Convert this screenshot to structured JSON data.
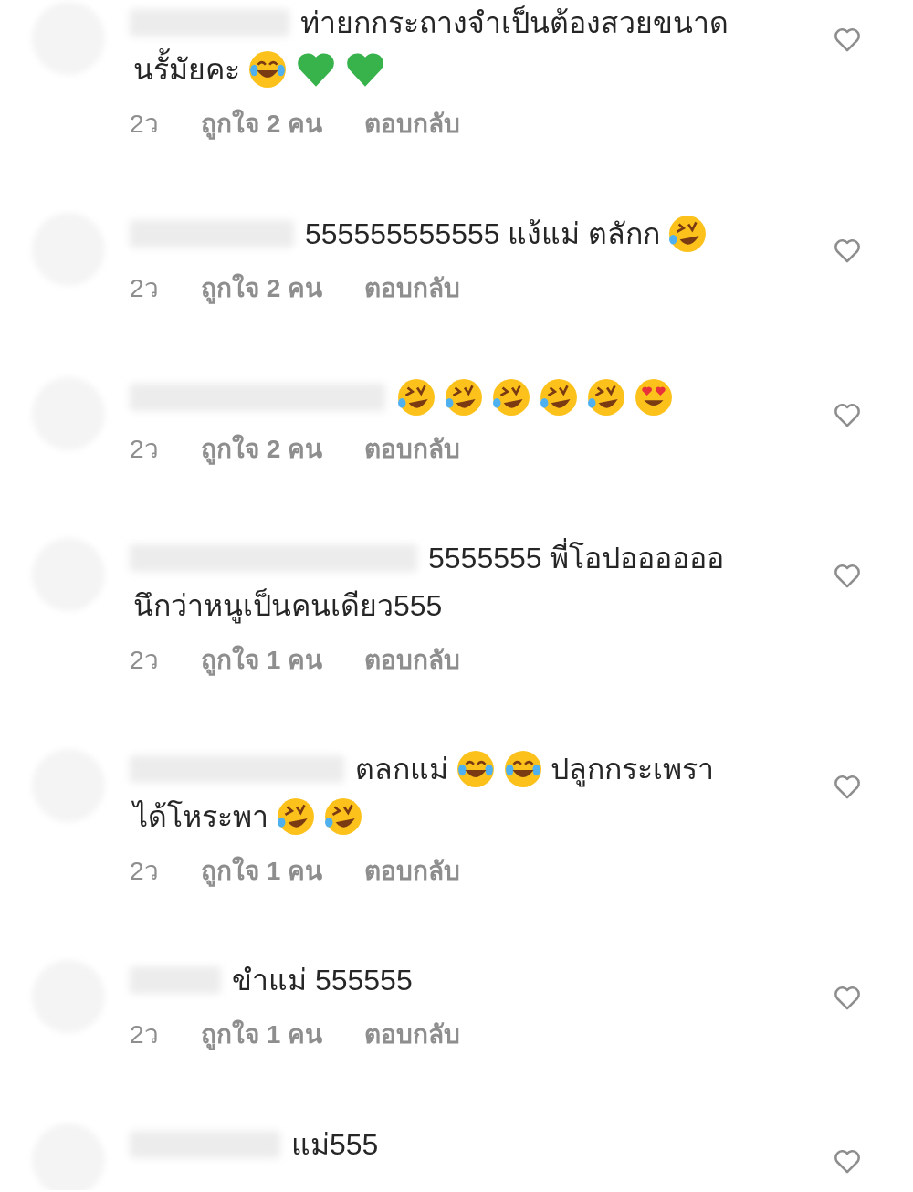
{
  "comments": [
    {
      "parts": [
        {
          "kind": "text",
          "text": "ท่ายกกระถางจำเป็นต้องสวยขนาด"
        },
        {
          "kind": "break"
        },
        {
          "kind": "text",
          "text": "นรั้มัยคะ"
        },
        {
          "kind": "joy"
        },
        {
          "kind": "green_heart"
        },
        {
          "kind": "green_heart"
        }
      ],
      "time": "2ว",
      "likes": "ถูกใจ 2 คน",
      "reply": "ตอบกลับ",
      "liked": false
    },
    {
      "parts": [
        {
          "kind": "text",
          "text": "555555555555 แง้แม่ ตลักก"
        },
        {
          "kind": "rofl"
        }
      ],
      "time": "2ว",
      "likes": "ถูกใจ 2 คน",
      "reply": "ตอบกลับ",
      "liked": false
    },
    {
      "parts": [
        {
          "kind": "rofl"
        },
        {
          "kind": "rofl"
        },
        {
          "kind": "rofl"
        },
        {
          "kind": "rofl"
        },
        {
          "kind": "rofl"
        },
        {
          "kind": "heart_eyes"
        }
      ],
      "time": "2ว",
      "likes": "ถูกใจ 2 คน",
      "reply": "ตอบกลับ",
      "liked": false
    },
    {
      "parts": [
        {
          "kind": "text",
          "text": "5555555 พี่โอปออออออ"
        },
        {
          "kind": "break"
        },
        {
          "kind": "text",
          "text": "นึกว่าหนูเป็นคนเดียว555"
        }
      ],
      "time": "2ว",
      "likes": "ถูกใจ 1 คน",
      "reply": "ตอบกลับ",
      "liked": false
    },
    {
      "parts": [
        {
          "kind": "text",
          "text": "ตลกแม่"
        },
        {
          "kind": "joy"
        },
        {
          "kind": "joy"
        },
        {
          "kind": "text",
          "text": "ปลูกกระเพรา"
        },
        {
          "kind": "break"
        },
        {
          "kind": "text",
          "text": "ได้โหระพา"
        },
        {
          "kind": "rofl"
        },
        {
          "kind": "rofl"
        }
      ],
      "time": "2ว",
      "likes": "ถูกใจ 1 คน",
      "reply": "ตอบกลับ",
      "liked": false
    },
    {
      "parts": [
        {
          "kind": "text",
          "text": "ขำแม่ 555555"
        }
      ],
      "time": "2ว",
      "likes": "ถูกใจ 1 คน",
      "reply": "ตอบกลับ",
      "liked": false
    },
    {
      "parts": [
        {
          "kind": "text",
          "text": "แม่555"
        }
      ],
      "liked": false
    }
  ]
}
